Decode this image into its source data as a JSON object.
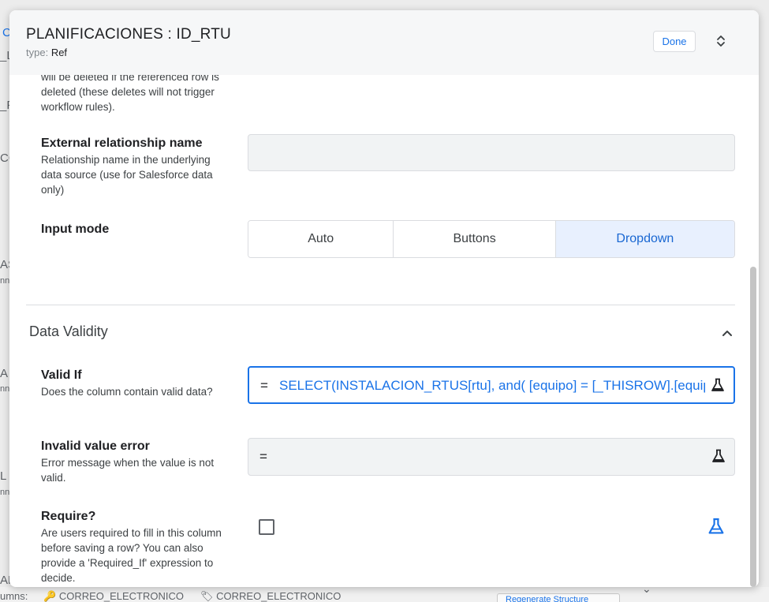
{
  "background": {
    "fragments": [
      "C",
      "_L",
      "_P",
      "CO",
      "AS",
      "nn",
      "A",
      "nn",
      "L",
      "nn",
      "AR"
    ],
    "bottom": {
      "columns_label": "umns:",
      "col1": "CORREO_ELECTRONICO",
      "col2": "CORREO_ELECTRONICO",
      "regenerate": "Regenerate Structure"
    }
  },
  "modal": {
    "title": "PLANIFICACIONES : ID_RTU",
    "type_key": "type:",
    "type_value": "Ref",
    "done_label": "Done"
  },
  "fields": {
    "cut_desc": "will be deleted if the referenced row is deleted (these deletes will not trigger workflow rules).",
    "external_rel": {
      "label": "External relationship name",
      "desc": "Relationship name in the underlying data source (use for Salesforce data only)",
      "value": ""
    },
    "input_mode": {
      "label": "Input mode",
      "options": [
        "Auto",
        "Buttons",
        "Dropdown"
      ],
      "selected": "Dropdown"
    }
  },
  "data_validity": {
    "title": "Data Validity",
    "valid_if": {
      "label": "Valid If",
      "desc": "Does the column contain valid data?",
      "eq": "=",
      "expression": "SELECT(INSTALACION_RTUS[rtu],   and( [equipo] = [_THISROW].[equipo]"
    },
    "invalid_error": {
      "label": "Invalid value error",
      "desc": "Error message when the value is not valid.",
      "eq": "=",
      "expression": ""
    },
    "require": {
      "label": "Require?",
      "desc": "Are users required to fill in this column before saving a row? You can also provide a 'Required_If' expression to decide.",
      "checked": false
    }
  },
  "colors": {
    "accent": "#1a73e8",
    "selected_bg": "#e8f0fe",
    "field_bg": "#f1f3f4"
  },
  "icons": [
    "expand-collapse-icon",
    "chevron-up-icon",
    "flask-icon",
    "chevron-down-icon"
  ]
}
